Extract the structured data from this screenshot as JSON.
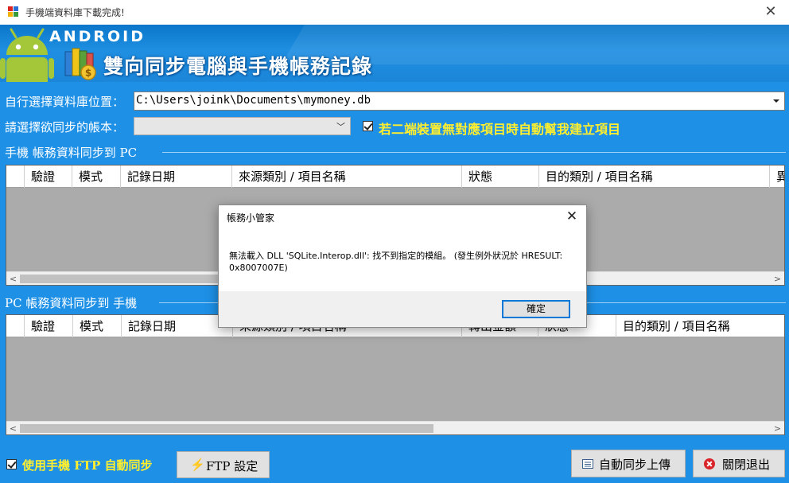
{
  "window": {
    "title": "手機端資料庫下載完成!",
    "close_glyph": "✕"
  },
  "banner": {
    "android_wordmark": "ANDROID",
    "title": "雙向同步電腦與手機帳務記錄"
  },
  "form": {
    "db_location_label": "自行選擇資料庫位置：",
    "db_path_value": "C:\\Users\\joink\\Documents\\mymoney.db",
    "account_label": "請選擇欲同步的帳本：",
    "account_value": "",
    "auto_create_label": "若二端裝置無對應項目時自動幫我建立項目",
    "auto_create_checked": true
  },
  "phone_to_pc": {
    "section_title": "手機 帳務資料同步到 PC",
    "columns": [
      "",
      "驗證",
      "模式",
      "記錄日期",
      "來源類別 / 項目名稱",
      "狀態",
      "目的類別 / 項目名稱",
      "異"
    ],
    "rows": []
  },
  "pc_to_phone": {
    "section_title": "PC 帳務資料同步到 手機",
    "columns": [
      "",
      "驗證",
      "模式",
      "記錄日期",
      "來源類別 / 項目名稱",
      "轉出金額",
      "狀態",
      "目的類別 / 項目名稱"
    ],
    "rows": []
  },
  "footer": {
    "ftp_sync_label": "使用手機 FTP 自動同步",
    "ftp_sync_checked": true,
    "ftp_settings_button": "FTP 設定",
    "auto_upload_button": "自動同步上傳",
    "close_exit_button": "關閉退出"
  },
  "dialog": {
    "title": "帳務小管家",
    "close_glyph": "✕",
    "message": "無法載入 DLL 'SQLite.Interop.dll': 找不到指定的模組。 (發生例外狀況於 HRESULT: 0x8007007E)",
    "ok_button": "確定"
  },
  "colors": {
    "window_bg": "#1e90e6",
    "highlight_text": "#ffef2e",
    "android_green": "#a4c639"
  },
  "icons": {
    "app": "app-window-icon",
    "android": "android-robot-icon",
    "books": "books-money-icon",
    "ftp": "lightning-icon",
    "upload": "list-icon",
    "exit": "red-x-circle-icon"
  }
}
